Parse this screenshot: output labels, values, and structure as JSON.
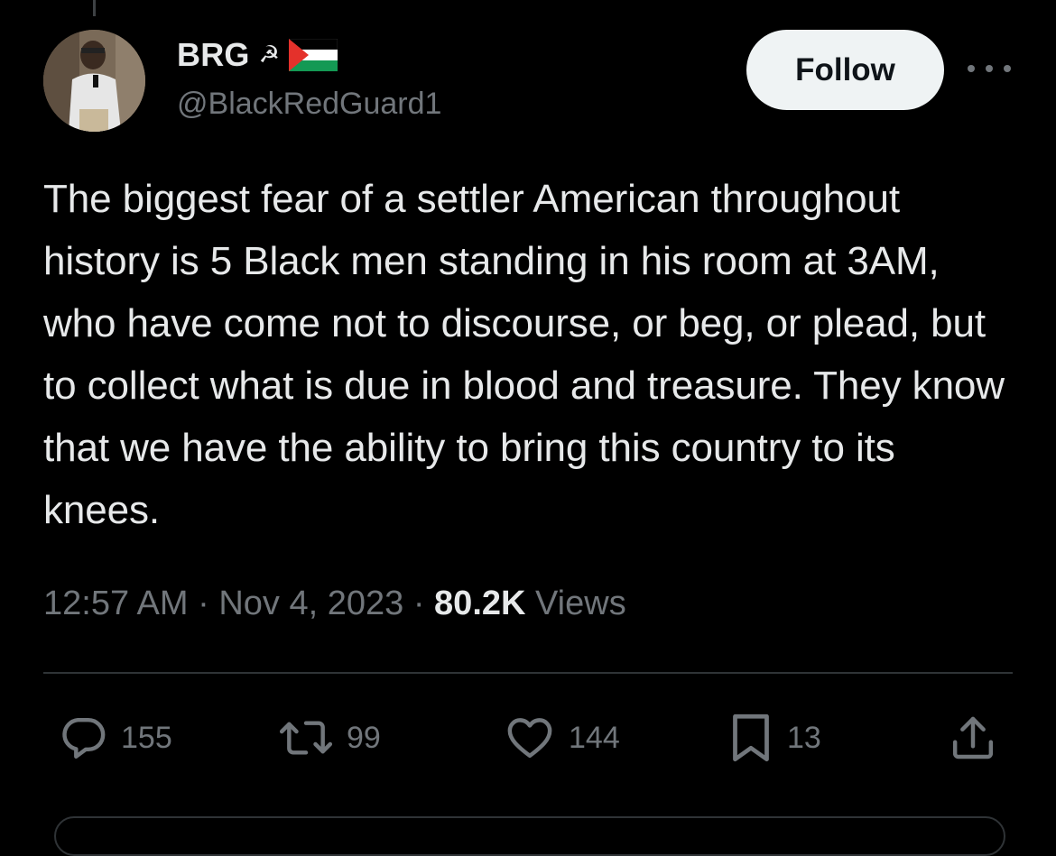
{
  "author": {
    "display_name": "BRG",
    "handle": "@BlackRedGuard1",
    "name_emoji": "☭"
  },
  "follow_label": "Follow",
  "tweet": {
    "text": "The biggest fear of a settler American throughout history is 5 Black men standing in his room at 3AM, who have come not to discourse, or beg, or plead, but to collect what is due in blood and treasure. They know that we have the ability to bring this country to its knees."
  },
  "meta": {
    "time": "12:57 AM",
    "separator": "·",
    "date": "Nov 4, 2023",
    "views_count": "80.2K",
    "views_label": "Views"
  },
  "actions": {
    "replies": "155",
    "reposts": "99",
    "likes": "144",
    "bookmarks": "13"
  },
  "colors": {
    "background": "#000000",
    "text_primary": "#e7e9ea",
    "text_secondary": "#71767b",
    "divider": "#2f3336",
    "follow_bg": "#eff3f4"
  },
  "icons": {
    "reply": "reply-bubble-icon",
    "repost": "repost-icon",
    "like": "heart-icon",
    "bookmark": "bookmark-icon",
    "share": "share-icon",
    "more": "more-dots-icon",
    "flag": "palestine-flag-icon"
  }
}
